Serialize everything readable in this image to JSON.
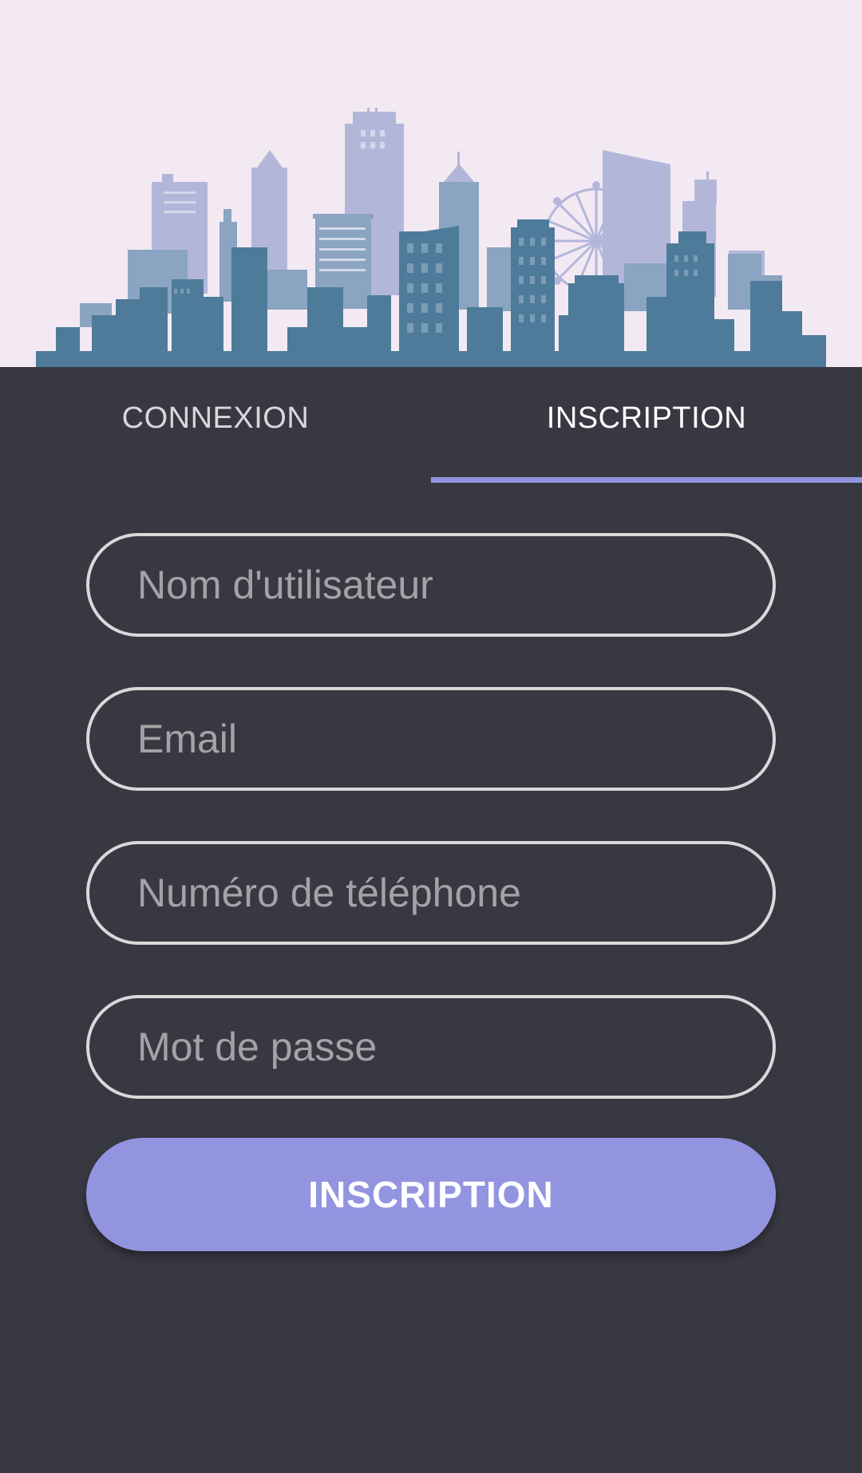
{
  "tabs": {
    "login_label": "CONNEXION",
    "signup_label": "INSCRIPTION",
    "active": "signup"
  },
  "form": {
    "username_placeholder": "Nom d'utilisateur",
    "email_placeholder": "Email",
    "phone_placeholder": "Numéro de téléphone",
    "password_placeholder": "Mot de passe",
    "submit_label": "INSCRIPTION"
  },
  "colors": {
    "hero_background": "#f3e9f3",
    "page_background": "#383842",
    "accent": "#9394e0",
    "field_border": "#d9d9d9"
  }
}
